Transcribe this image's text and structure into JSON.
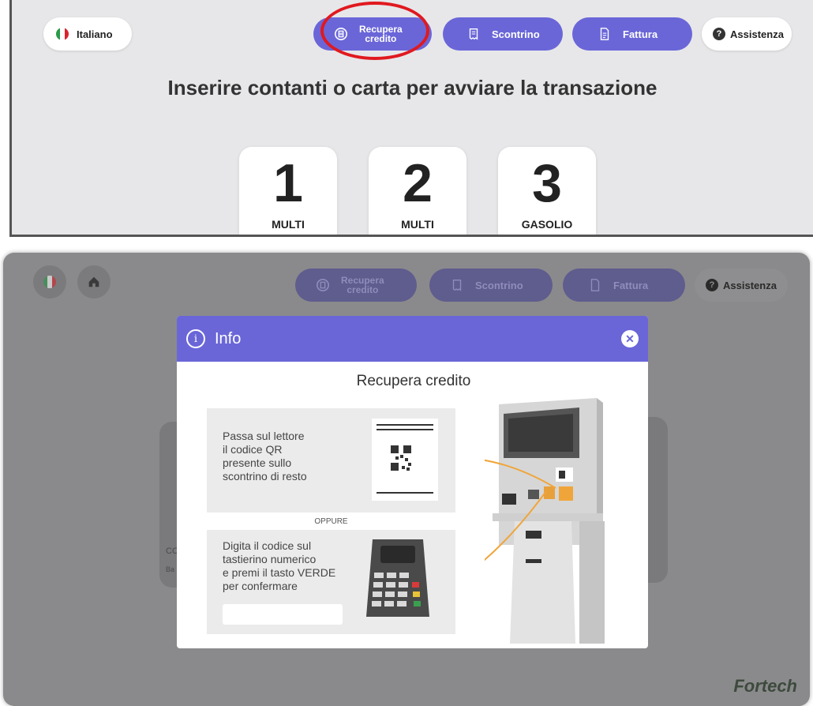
{
  "top": {
    "language": "Italiano",
    "buttons": {
      "recupera_l1": "Recupera",
      "recupera_l2": "credito",
      "scontrino": "Scontrino",
      "fattura": "Fattura",
      "assistenza": "Assistenza"
    },
    "title": "Inserire contanti o carta per avviare la transazione",
    "pumps": [
      {
        "number": "1",
        "label": "MULTI"
      },
      {
        "number": "2",
        "label": "MULTI"
      },
      {
        "number": "3",
        "label": "GASOLIO"
      }
    ]
  },
  "bottom": {
    "buttons": {
      "recupera_l1": "Recupera",
      "recupera_l2": "credito",
      "scontrino": "Scontrino",
      "fattura": "Fattura",
      "assistenza": "Assistenza"
    },
    "bg_text_1": "CC",
    "bg_text_2": "Ba",
    "brand": "Fortech"
  },
  "modal": {
    "header": "Info",
    "title": "Recupera credito",
    "step1_lines": [
      "Passa sul lettore",
      "il codice QR",
      "presente sullo",
      "scontrino di resto"
    ],
    "separator": "OPPURE",
    "step2_lines": [
      "Digita il codice sul",
      "tastierino numerico",
      "e premi il tasto VERDE",
      "per confermare"
    ]
  },
  "colors": {
    "accent": "#6a66d8",
    "highlight_ring": "#e0191f",
    "connector": "#f0a53a"
  },
  "icons": [
    "italian-flag-icon",
    "refresh-receipt-icon",
    "receipt-icon",
    "invoice-icon",
    "question-icon",
    "home-icon",
    "info-icon",
    "close-icon",
    "qr-code-icon",
    "keypad-icon",
    "kiosk-icon"
  ]
}
